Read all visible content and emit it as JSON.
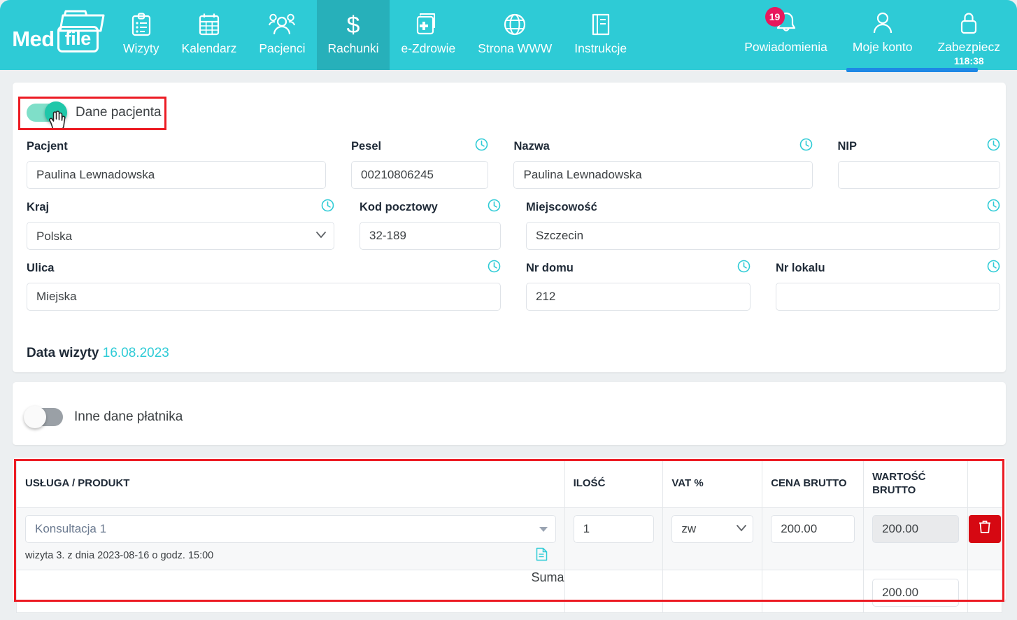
{
  "brand": {
    "name_part1": "Med",
    "name_part2": "file",
    "accent_color": "#2ecbd6",
    "active_tab_color": "#27b0ba",
    "danger_color": "#d60812",
    "badge_color": "#e8185d"
  },
  "navbar": {
    "items": [
      {
        "label": "Wizyty",
        "icon": "clipboard-list-icon",
        "active": false
      },
      {
        "label": "Kalendarz",
        "icon": "calendar-icon",
        "active": false
      },
      {
        "label": "Pacjenci",
        "icon": "users-icon",
        "active": false
      },
      {
        "label": "Rachunki",
        "icon": "dollar-icon",
        "active": true
      },
      {
        "label": "e-Zdrowie",
        "icon": "medical-card-icon",
        "active": false
      },
      {
        "label": "Strona WWW",
        "icon": "globe-icon",
        "active": false
      },
      {
        "label": "Instrukcje",
        "icon": "book-icon",
        "active": false
      }
    ],
    "right_items": [
      {
        "label": "Powiadomienia",
        "icon": "bell-icon",
        "badge": "19"
      },
      {
        "label": "Moje konto",
        "icon": "user-icon",
        "badge": ""
      },
      {
        "label": "Zabezpiecz",
        "icon": "lock-icon",
        "badge": "",
        "timer": "118:38"
      }
    ]
  },
  "patient_section": {
    "toggle": {
      "label": "Dane pacjenta",
      "state": "on"
    },
    "fields_row1": [
      {
        "label": "Pacjent",
        "value": "Paulina Lewnadowska",
        "placeholder": "",
        "has_clock": false,
        "type": "text"
      },
      {
        "label": "Pesel",
        "value": "00210806245",
        "placeholder": "",
        "has_clock": true,
        "type": "text"
      },
      {
        "label": "Nazwa",
        "value": "Paulina Lewnadowska",
        "placeholder": "",
        "has_clock": true,
        "type": "text"
      },
      {
        "label": "NIP",
        "value": "",
        "placeholder": "",
        "has_clock": true,
        "type": "text"
      }
    ],
    "fields_row2": [
      {
        "label": "Kraj",
        "value": "Polska",
        "placeholder": "",
        "has_clock": true,
        "type": "select"
      },
      {
        "label": "Kod pocztowy",
        "value": "32-189",
        "placeholder": "",
        "has_clock": true,
        "type": "text"
      },
      {
        "label": "Miejscowość",
        "value": "Szczecin",
        "placeholder": "",
        "has_clock": true,
        "type": "text"
      }
    ],
    "fields_row3": [
      {
        "label": "Ulica",
        "value": "Miejska",
        "placeholder": "",
        "has_clock": true,
        "type": "text"
      },
      {
        "label": "Nr domu",
        "value": "212",
        "placeholder": "",
        "has_clock": true,
        "type": "text"
      },
      {
        "label": "Nr lokalu",
        "value": "",
        "placeholder": "",
        "has_clock": true,
        "type": "text"
      }
    ],
    "visit_date_label": "Data wizyty",
    "visit_date_value": "16.08.2023"
  },
  "payer_section": {
    "toggle": {
      "label": "Inne dane płatnika",
      "state": "off"
    }
  },
  "items_table": {
    "headers": [
      "USŁUGA / PRODUKT",
      "ILOŚĆ",
      "VAT %",
      "CENA BRUTTO",
      "WARTOŚĆ BRUTTO",
      ""
    ],
    "rows": [
      {
        "service": "Konsultacja 1",
        "sub_text": "wizyta 3. z dnia 2023-08-16 o godz. 15:00",
        "sub_icon": "document-icon",
        "quantity": "1",
        "vat": "zw",
        "price_gross": "200.00",
        "value_gross": "200.00",
        "delete_icon": "trash-icon"
      }
    ],
    "summary": {
      "label": "Suma",
      "value": "200.00"
    }
  }
}
